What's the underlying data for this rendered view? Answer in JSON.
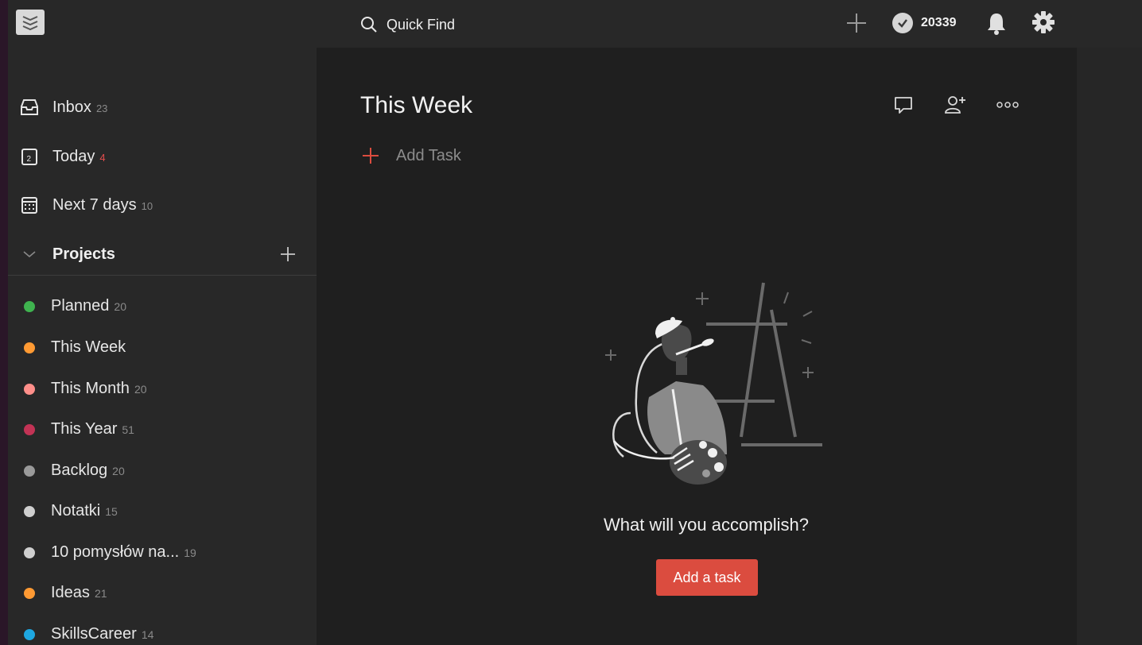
{
  "topbar": {
    "search_placeholder": "Quick Find",
    "karma_points": "20339"
  },
  "sidebar": {
    "nav": [
      {
        "label": "Inbox",
        "count": "23"
      },
      {
        "label": "Today",
        "count": "4"
      },
      {
        "label": "Next 7 days",
        "count": "10"
      }
    ],
    "projects_label": "Projects",
    "projects": [
      {
        "label": "Planned",
        "count": "20",
        "color": "#3fb34f"
      },
      {
        "label": "This Week",
        "count": "",
        "color": "#ff9a33"
      },
      {
        "label": "This Month",
        "count": "20",
        "color": "#ff8f8a"
      },
      {
        "label": "This Year",
        "count": "51",
        "color": "#c23355"
      },
      {
        "label": "Backlog",
        "count": "20",
        "color": "#9a9a9a"
      },
      {
        "label": "Notatki",
        "count": "15",
        "color": "#cfcfcf"
      },
      {
        "label": "10 pomysłów na...",
        "count": "19",
        "color": "#cfcfcf"
      },
      {
        "label": "Ideas",
        "count": "21",
        "color": "#ff9a33"
      },
      {
        "label": "SkillsCareer",
        "count": "14",
        "color": "#1ea7e1"
      }
    ]
  },
  "main": {
    "title": "This Week",
    "add_task_label": "Add Task",
    "empty_message": "What will you accomplish?",
    "cta_label": "Add a task"
  },
  "colors": {
    "accent": "#db4c3f",
    "today_count": "#e44d4d"
  }
}
